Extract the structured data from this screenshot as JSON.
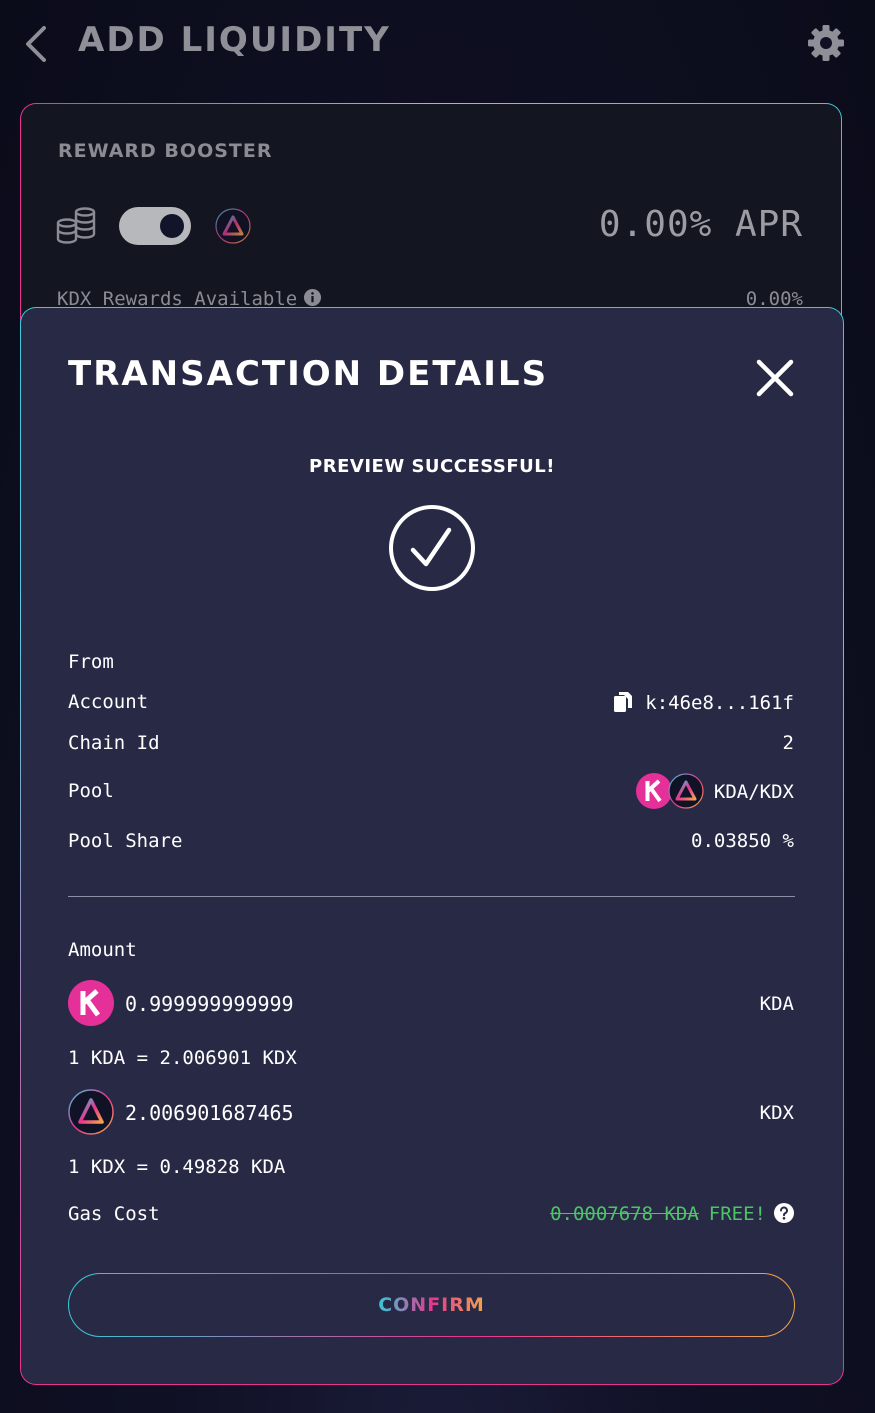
{
  "header": {
    "title": "ADD LIQUIDITY"
  },
  "booster": {
    "title": "REWARD BOOSTER",
    "apr": "0.00% APR",
    "rewards_label": "KDX Rewards Available",
    "rewards_value": "0.00%",
    "toggle_on": true
  },
  "modal": {
    "title": "TRANSACTION DETAILS",
    "preview": "PREVIEW SUCCESSFUL!",
    "from_label": "From",
    "account_label": "Account",
    "account_value": "k:46e8...161f",
    "chain_label": "Chain Id",
    "chain_value": "2",
    "pool_label": "Pool",
    "pool_value": "KDA/KDX",
    "share_label": "Pool Share",
    "share_value": "0.03850 %",
    "amount_label": "Amount",
    "amounts": [
      {
        "value": "0.999999999999",
        "token": "KDA",
        "icon": "kda-logo"
      },
      {
        "value": "2.006901687465",
        "token": "KDX",
        "icon": "kdx-logo"
      }
    ],
    "rates": [
      "1 KDA = 2.006901 KDX",
      "1 KDX = 0.49828 KDA"
    ],
    "gas_label": "Gas Cost",
    "gas_value": "0.0007678 KDA",
    "gas_free": "FREE!",
    "confirm_label": "CONFIRM"
  },
  "colors": {
    "kda_pink": "#e5309a",
    "accent_cyan": "#37c9d8",
    "accent_orange": "#f0a64b",
    "free_green": "#4cc466",
    "modal_bg": "#282a45"
  }
}
